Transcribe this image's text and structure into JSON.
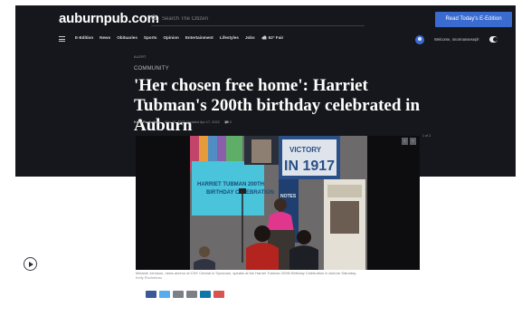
{
  "site": {
    "logo": "auburnpub.com",
    "search_placeholder": "Search The Citizen",
    "eedition_label": "Read Today's E-Edition"
  },
  "nav": {
    "items": [
      "E-Edition",
      "News",
      "Obituaries",
      "Sports",
      "Opinion",
      "Entertainment",
      "Lifestyles",
      "Jobs"
    ],
    "weather": "62° Fair",
    "welcome": "Welcome, nnormansesepl!"
  },
  "article": {
    "alert_tag": "ALERT",
    "section": "COMMUNITY",
    "headline": "'Her chosen free home': Harriet Tubman's 200th birthday celebrated in Auburn",
    "author": "Kelly Rocheleau",
    "dates": "Mar 10, 2022 Updated Apr 17, 2022",
    "comment_count": "0",
    "photo_count": "1 of 3",
    "caption": "Melanie Johnson, news anchor at CNY Central in Syracuse, speaks at the Harriet Tubman 200th Birthday Celebration in Auburn Saturday.",
    "photo_credit": "Kelly Rocheleau",
    "photo_sign_text": [
      "VICTORY IN 1917",
      "HARRIET TUBMAN 200TH BIRTHDAY CELEBRATION",
      "NOTES"
    ]
  },
  "colors": {
    "header_bg": "#16171c",
    "accent_blue": "#3a6bd0",
    "share_facebook": "#3b5998",
    "share_twitter": "#55acee",
    "share_email": "#7d7f86",
    "share_print": "#7d7f86",
    "share_linkedin": "#0e76a8",
    "share_pinterest": "#d9534f"
  },
  "share": {
    "buttons": [
      "facebook-icon",
      "twitter-icon",
      "email-icon",
      "print-icon",
      "linkedin-icon",
      "pinterest-icon"
    ]
  }
}
